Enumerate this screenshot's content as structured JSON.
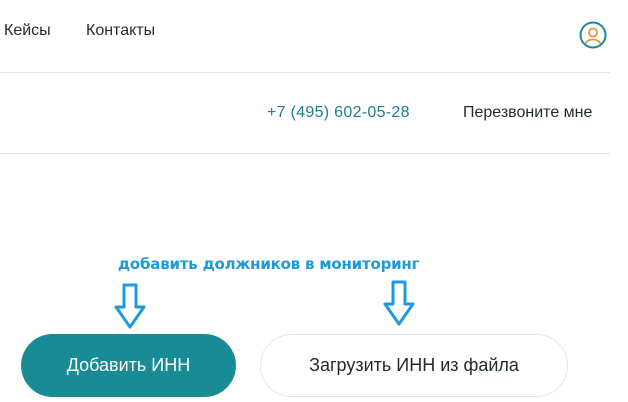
{
  "nav": {
    "items": [
      {
        "label": "Кейсы"
      },
      {
        "label": "Контакты"
      }
    ],
    "user_icon": "user-circle-icon"
  },
  "contacts": {
    "phone": "+7 (495) 602-05-28",
    "callback": "Перезвоните мне"
  },
  "annotation": {
    "text": "добавить должников в мониторинг",
    "color": "#1e9bd7",
    "arrow_icon": "down-arrow-outline-icon"
  },
  "actions": {
    "add_inn": "Добавить ИНН",
    "upload_inn": "Загрузить ИНН из файла"
  },
  "colors": {
    "accent": "#188b96",
    "phone": "#1b7e8d",
    "text": "#1f2a2f"
  }
}
